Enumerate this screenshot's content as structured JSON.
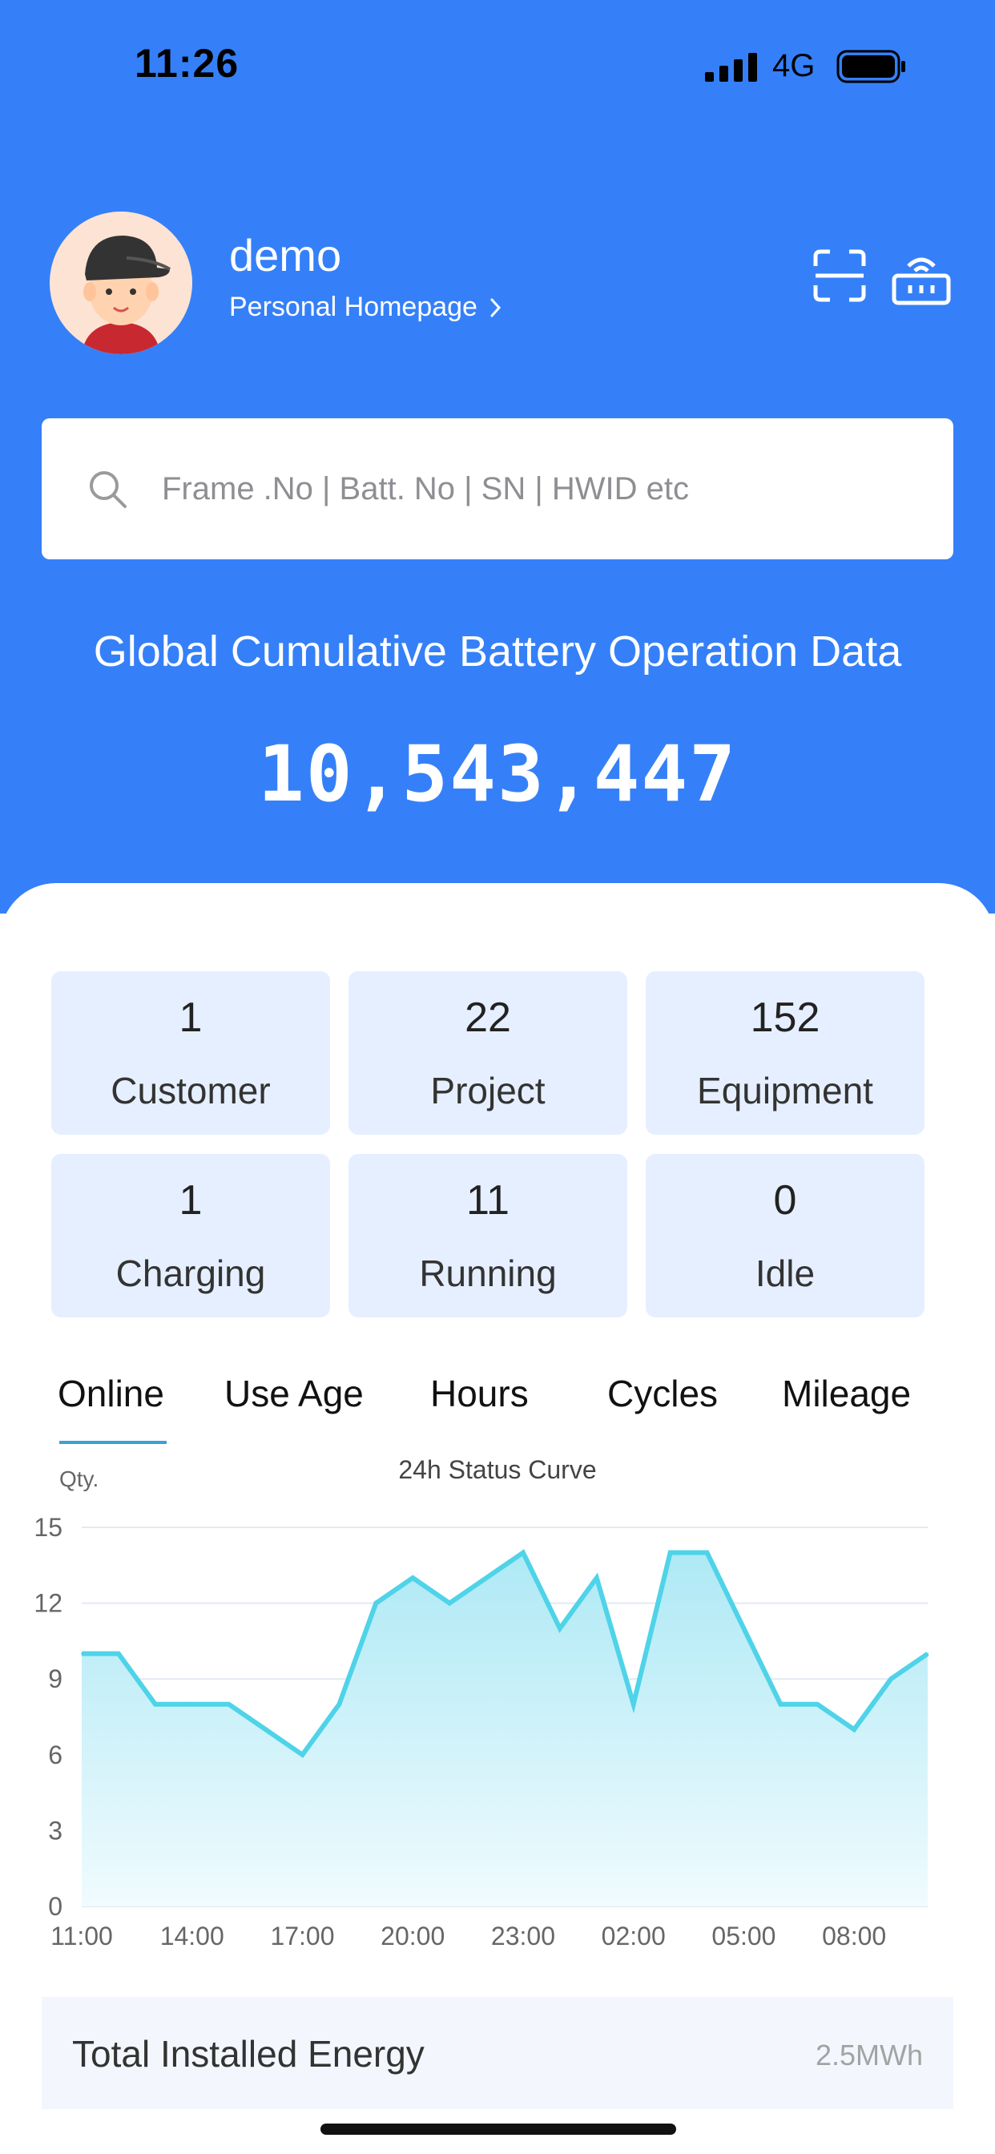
{
  "status_bar": {
    "time": "11:26",
    "network": "4G"
  },
  "profile": {
    "username": "demo",
    "homepage_link": "Personal Homepage"
  },
  "search": {
    "placeholder": "Frame .No | Batt. No | SN | HWID etc"
  },
  "global": {
    "title": "Global Cumulative Battery Operation Data",
    "value": "10,543,447"
  },
  "stats": [
    {
      "value": "1",
      "label": "Customer"
    },
    {
      "value": "22",
      "label": "Project"
    },
    {
      "value": "152",
      "label": "Equipment"
    },
    {
      "value": "1",
      "label": "Charging"
    },
    {
      "value": "11",
      "label": "Running"
    },
    {
      "value": "0",
      "label": "Idle"
    }
  ],
  "tabs": [
    {
      "label": "Online",
      "active": true
    },
    {
      "label": "Use Age",
      "active": false
    },
    {
      "label": "Hours",
      "active": false
    },
    {
      "label": "Cycles",
      "active": false
    },
    {
      "label": "Mileage",
      "active": false
    }
  ],
  "chart_data": {
    "type": "area",
    "title": "24h Status Curve",
    "ylabel": "Qty.",
    "xlabel": "",
    "ylim": [
      0,
      15
    ],
    "yticks": [
      0,
      3,
      6,
      9,
      12,
      15
    ],
    "xticks": [
      "11:00",
      "14:00",
      "17:00",
      "20:00",
      "23:00",
      "02:00",
      "05:00",
      "08:00"
    ],
    "x": [
      "11:00",
      "12:00",
      "13:00",
      "14:00",
      "15:00",
      "16:00",
      "17:00",
      "18:00",
      "19:00",
      "20:00",
      "21:00",
      "22:00",
      "23:00",
      "00:00",
      "01:00",
      "02:00",
      "03:00",
      "04:00",
      "05:00",
      "06:00",
      "07:00",
      "08:00",
      "09:00",
      "10:00"
    ],
    "values": [
      10,
      10,
      8,
      8,
      8,
      7,
      6,
      8,
      12,
      13,
      12,
      13,
      14,
      11,
      13,
      8,
      14,
      14,
      11,
      8,
      8,
      7,
      9,
      10
    ],
    "grid": true,
    "colors": {
      "line": "#4fd3e8",
      "fill_top": "#aee9f5",
      "fill_bottom": "#f0fbfe"
    }
  },
  "energy": {
    "label": "Total Installed Energy",
    "value": "2.5MWh"
  },
  "colors": {
    "brand": "#3580f8",
    "card": "#e6efff"
  }
}
